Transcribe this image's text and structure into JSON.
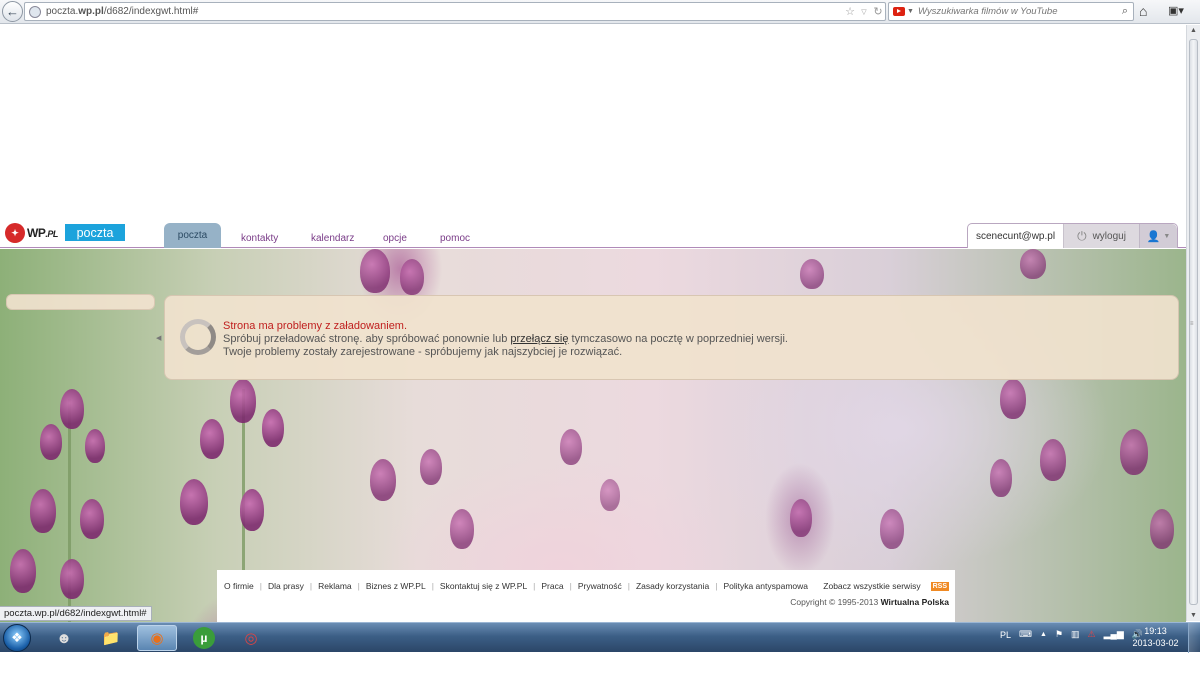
{
  "browser": {
    "url_prefix": "poczta.",
    "url_host": "wp.pl",
    "url_path": "/d682/indexgwt.html#",
    "search_placeholder": "Wyszukiwarka filmów w YouTube",
    "status_url": "poczta.wp.pl/d682/indexgwt.html#"
  },
  "header": {
    "logo_text": "WP",
    "logo_suffix": ".PL",
    "brand": "poczta",
    "tabs": [
      {
        "label": "poczta",
        "active": true
      },
      {
        "label": "kontakty"
      },
      {
        "label": "kalendarz"
      },
      {
        "label": "opcje"
      },
      {
        "label": "pomoc"
      }
    ],
    "user_email": "scenecunt@wp.pl",
    "logout_label": "wyloguj"
  },
  "error": {
    "title": "Strona ma problemy z załadowaniem.",
    "line1_before": "Spróbuj przeładować stronę. aby spróbować ponownie lub ",
    "line1_link": "przełącz się",
    "line1_after": " tymczasowo na pocztę w poprzedniej wersji.",
    "line2": "Twoje problemy zostały zarejestrowane - spróbujemy jak najszybciej je rozwiązać."
  },
  "footer": {
    "links": [
      "O firmie",
      "Dla prasy",
      "Reklama",
      "Biznes z WP.PL",
      "Skontaktuj się z WP.PL",
      "Praca",
      "Prywatność",
      "Zasady korzystania",
      "Polityka antyspamowa"
    ],
    "all_services": "Zobacz wszystkie serwisy",
    "rss": "RSS",
    "copyright": "Copyright © 1995-2013 ",
    "company": "Wirtualna Polska"
  },
  "taskbar": {
    "language": "PL",
    "time": "19:13",
    "date": "2013-03-02"
  }
}
